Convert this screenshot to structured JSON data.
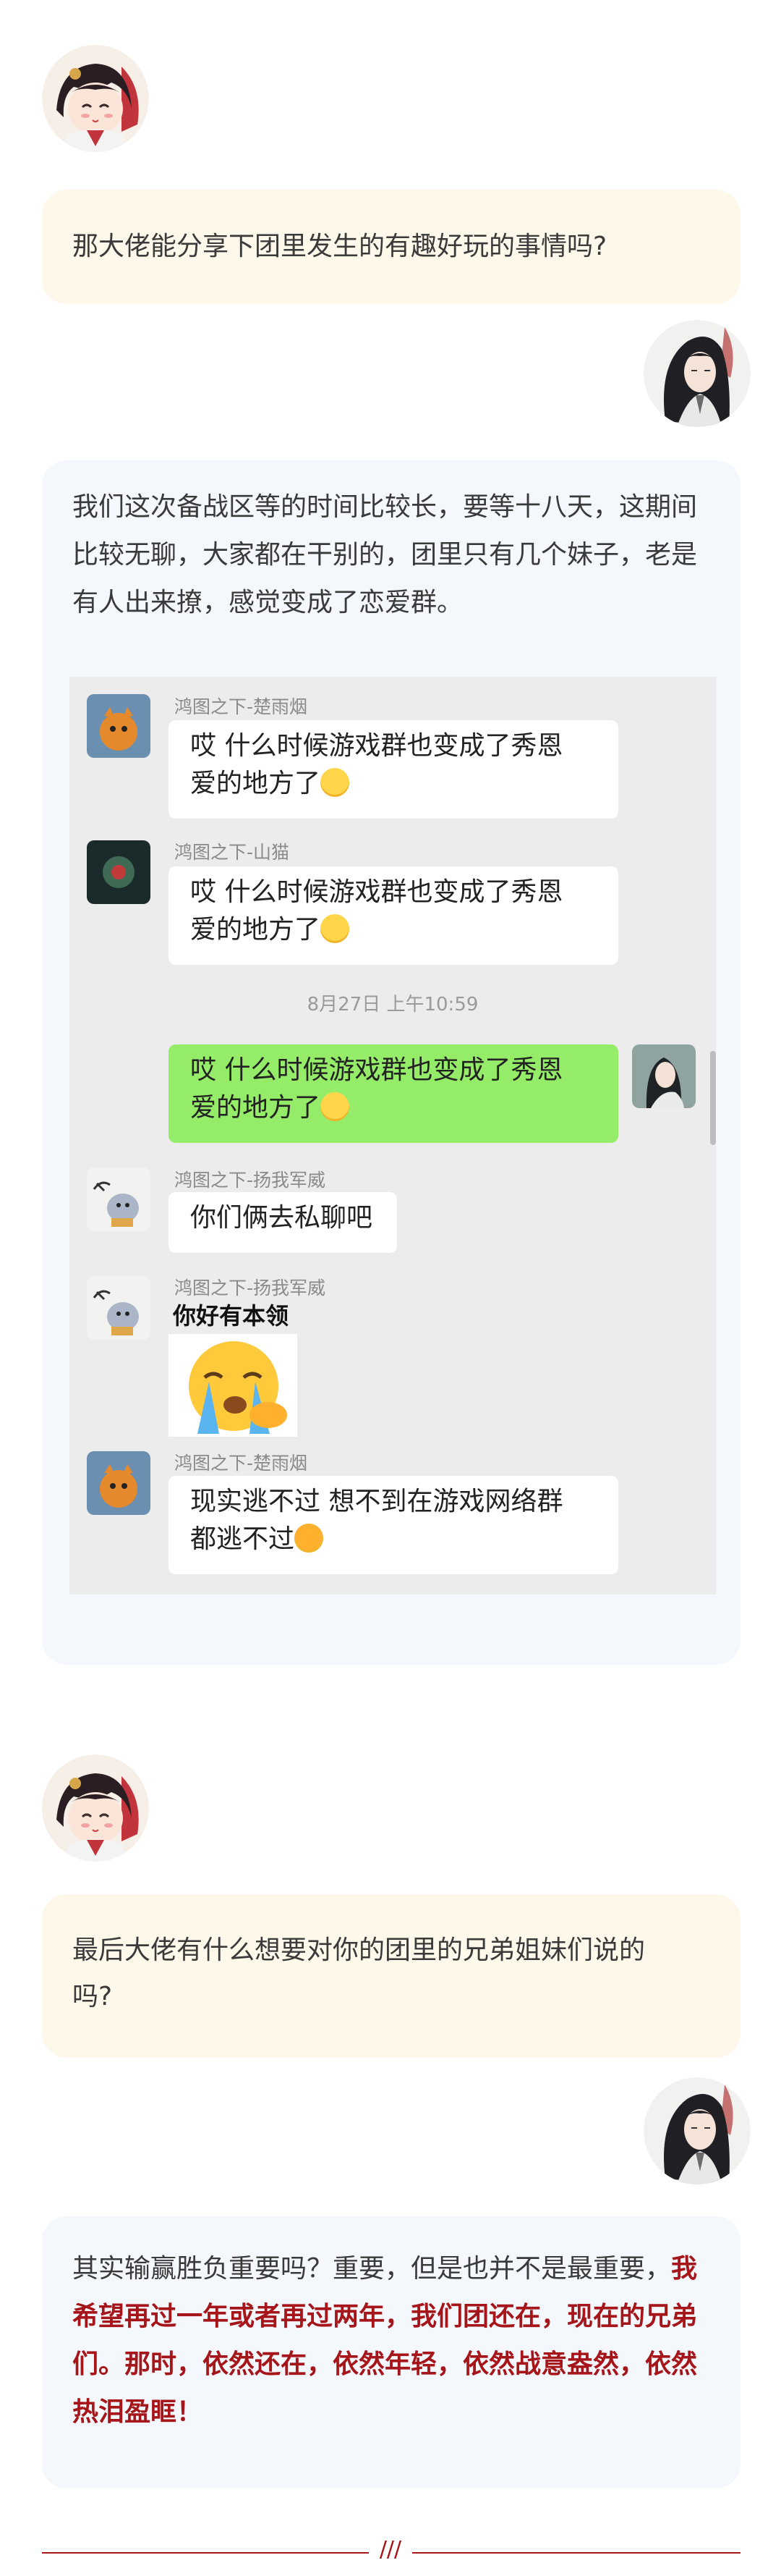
{
  "section1": {
    "question": "那大佬能分享下团里发生的有趣好玩的事情吗?",
    "answer": "我们这次备战区等的时间比较长，要等十八天，这期间比较无聊，大家都在干别的，团里只有几个妹子，老是有人出来撩，感觉变成了恋爱群。"
  },
  "chat": {
    "messages": [
      {
        "sender": "鸿图之下-楚雨烟",
        "text_line1": "哎  什么时候游戏群也变成了秀恩",
        "text_line2": "爱的地方了"
      },
      {
        "sender": "鸿图之下-山猫",
        "text_line1": "哎  什么时候游戏群也变成了秀恩",
        "text_line2": "爱的地方了"
      },
      {
        "text_line1": "哎  什么时候游戏群也变成了秀恩",
        "text_line2": "爱的地方了"
      },
      {
        "sender": "鸿图之下-扬我军威",
        "text": "你们俩去私聊吧"
      },
      {
        "sender": "鸿图之下-扬我军威",
        "text": "你好有本领"
      },
      {
        "sender": "鸿图之下-楚雨烟",
        "text_line1": "现实逃不过  想不到在游戏网络群",
        "text_line2": "都逃不过"
      }
    ],
    "timestamp": "8月27日 上午10:59"
  },
  "section2": {
    "question_line1": "最后大佬有什么想要对你的团里的兄弟姐妹们说的",
    "question_line2": "吗?",
    "answer_plain": "其实输赢胜负重要吗？重要，但是也并不是最重要，",
    "answer_red": "我希望再过一年或者再过两年，我们团还在，现在的兄弟们。那时，依然还在，依然年轻，依然战意盎然，依然热泪盈眶！"
  },
  "footer": {
    "mark": "///"
  },
  "colors": {
    "accent": "#a5151a",
    "question_bg": "#fdf8ea",
    "answer_bg": "#f4f7fb",
    "chat_bg": "#ececec",
    "my_bubble": "#95ec69"
  }
}
